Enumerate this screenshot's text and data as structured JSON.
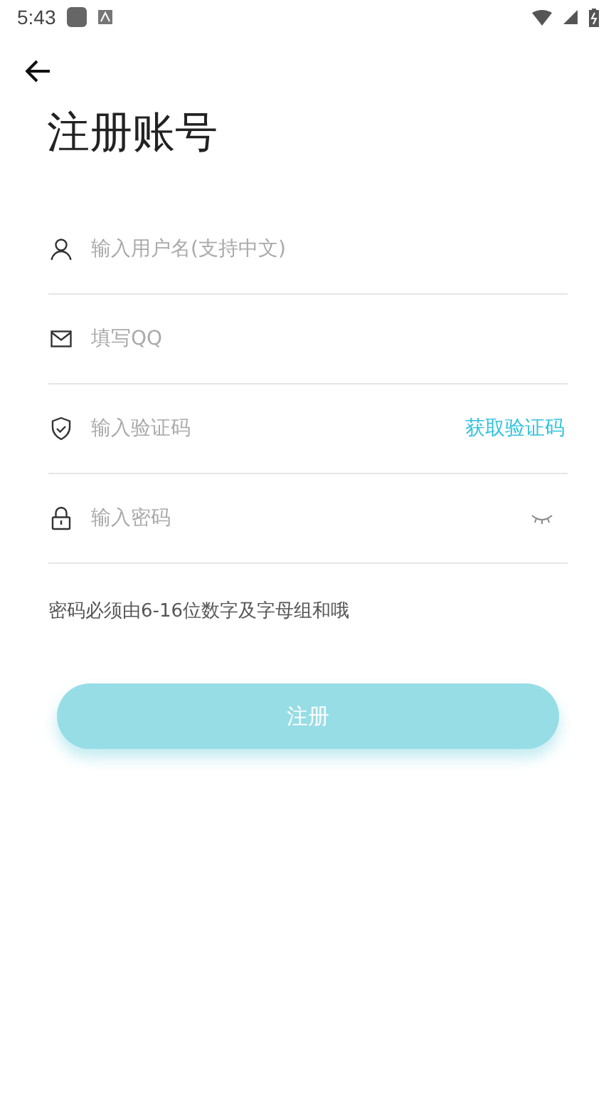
{
  "status_bar": {
    "time": "5:43"
  },
  "title": "注册账号",
  "fields": [
    {
      "kind": "user",
      "placeholder": "输入用户名(支持中文)"
    },
    {
      "kind": "mail",
      "placeholder": "填写QQ"
    },
    {
      "kind": "code",
      "placeholder": "输入验证码",
      "action": "获取验证码"
    },
    {
      "kind": "password",
      "placeholder": "输入密码",
      "password_visible": false
    }
  ],
  "hint": "密码必须由6-16位数字及字母组和哦",
  "submit": {
    "label": "注册"
  }
}
